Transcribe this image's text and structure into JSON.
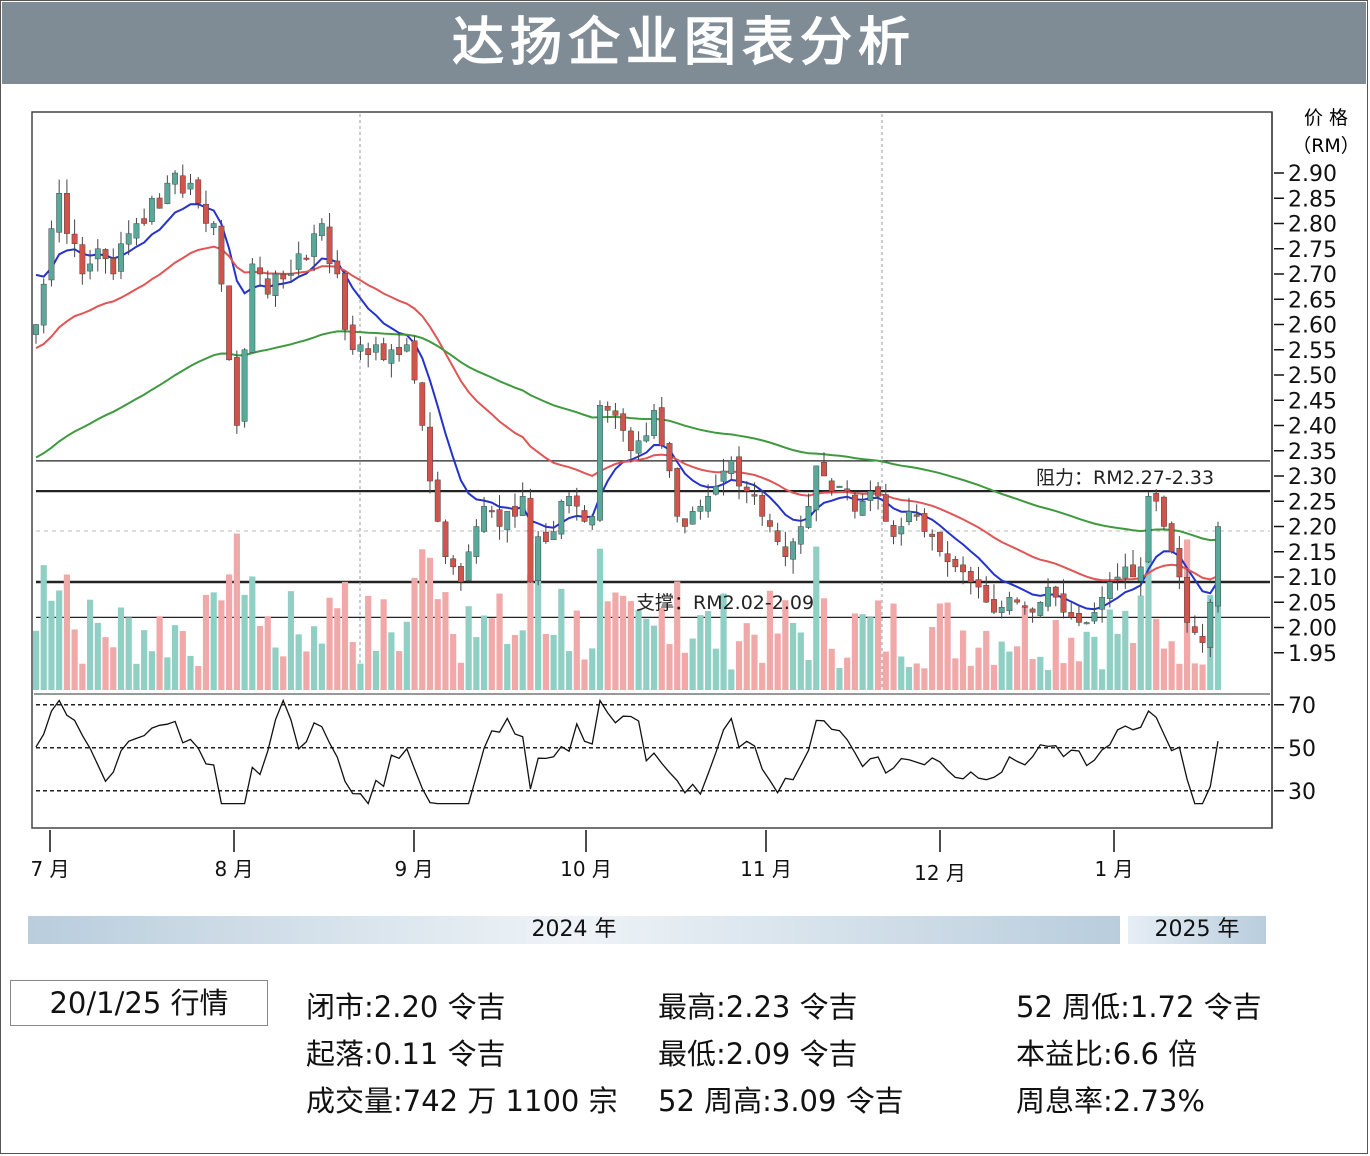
{
  "title": "达扬企业图表分析",
  "chart_data": {
    "type": "candlestick",
    "y_axis_unit": [
      "价 格",
      "（RM）"
    ],
    "ylim": [
      1.92,
      2.92
    ],
    "y_ticks": [
      "2.90",
      "2.85",
      "2.80",
      "2.75",
      "2.70",
      "2.65",
      "2.60",
      "2.55",
      "2.50",
      "2.45",
      "2.40",
      "2.35",
      "2.30",
      "2.25",
      "2.20",
      "2.15",
      "2.10",
      "2.05",
      "2.00",
      "1.95"
    ],
    "rsi_ticks": [
      "70",
      "50",
      "30"
    ],
    "x_months": [
      "7 月",
      "8 月",
      "9 月",
      "10 月",
      "11 月",
      "12 月",
      "1 月"
    ],
    "years": [
      "2024 年",
      "2025 年"
    ],
    "resistance": {
      "label": "阻力：RM2.27-2.33",
      "low": 2.27,
      "high": 2.33
    },
    "support": {
      "label": "支撑：RM2.02-2.09",
      "low": 2.02,
      "high": 2.09
    },
    "colors": {
      "up": "#5aa89a",
      "down": "#d0544c",
      "ema_fast": "#2433cc",
      "ema_mid": "#e05555",
      "ema_slow": "#3f9a3f",
      "vol_up": "#8fcfc4",
      "vol_down": "#f0a8a8"
    },
    "closes": [
      2.6,
      2.68,
      2.79,
      2.86,
      2.78,
      2.76,
      2.7,
      2.72,
      2.75,
      2.73,
      2.7,
      2.76,
      2.78,
      2.8,
      2.8,
      2.85,
      2.83,
      2.88,
      2.9,
      2.86,
      2.88,
      2.84,
      2.8,
      2.8,
      2.68,
      2.53,
      2.4,
      2.55,
      2.72,
      2.7,
      2.66,
      2.7,
      2.69,
      2.7,
      2.74,
      2.73,
      2.78,
      2.8,
      2.72,
      2.7,
      2.59,
      2.55,
      2.56,
      2.54,
      2.56,
      2.53,
      2.55,
      2.54,
      2.56,
      2.49,
      2.4,
      2.29,
      2.21,
      2.14,
      2.12,
      2.09,
      2.15,
      2.2,
      2.24,
      2.23,
      2.2,
      2.23,
      2.22,
      2.26,
      2.09,
      2.18,
      2.17,
      2.19,
      2.25,
      2.26,
      2.24,
      2.21,
      2.22,
      2.44,
      2.43,
      2.42,
      2.39,
      2.35,
      2.37,
      2.38,
      2.43,
      2.36,
      2.31,
      2.22,
      2.2,
      2.23,
      2.24,
      2.26,
      2.28,
      2.31,
      2.33,
      2.28,
      2.27,
      2.26,
      2.22,
      2.2,
      2.17,
      2.14,
      2.17,
      2.2,
      2.24,
      2.32,
      2.3,
      2.27,
      2.28,
      2.27,
      2.23,
      2.25,
      2.27,
      2.26,
      2.21,
      2.18,
      2.2,
      2.23,
      2.22,
      2.19,
      2.18,
      2.15,
      2.13,
      2.12,
      2.11,
      2.09,
      2.08,
      2.05,
      2.03,
      2.04,
      2.06,
      2.05,
      2.04,
      2.03,
      2.05,
      2.08,
      2.06,
      2.03,
      2.02,
      2.01,
      2.01,
      2.03,
      2.06,
      2.09,
      2.1,
      2.12,
      2.1,
      2.12,
      2.26,
      2.25,
      2.2,
      2.15,
      2.1,
      2.01,
      1.99,
      1.97,
      2.05,
      2.2
    ]
  },
  "quote": {
    "date": "20/1/25 行情",
    "close": "闭市:2.20 令吉",
    "change": "起落:0.11 令吉",
    "volume": "成交量:742 万 1100 宗",
    "high": "最高:2.23 令吉",
    "low": "最低:2.09 令吉",
    "high52": "52 周高:3.09 令吉",
    "low52": "52 周低:1.72 令吉",
    "pe": "本益比:6.6 倍",
    "dy": "周息率:2.73%"
  }
}
